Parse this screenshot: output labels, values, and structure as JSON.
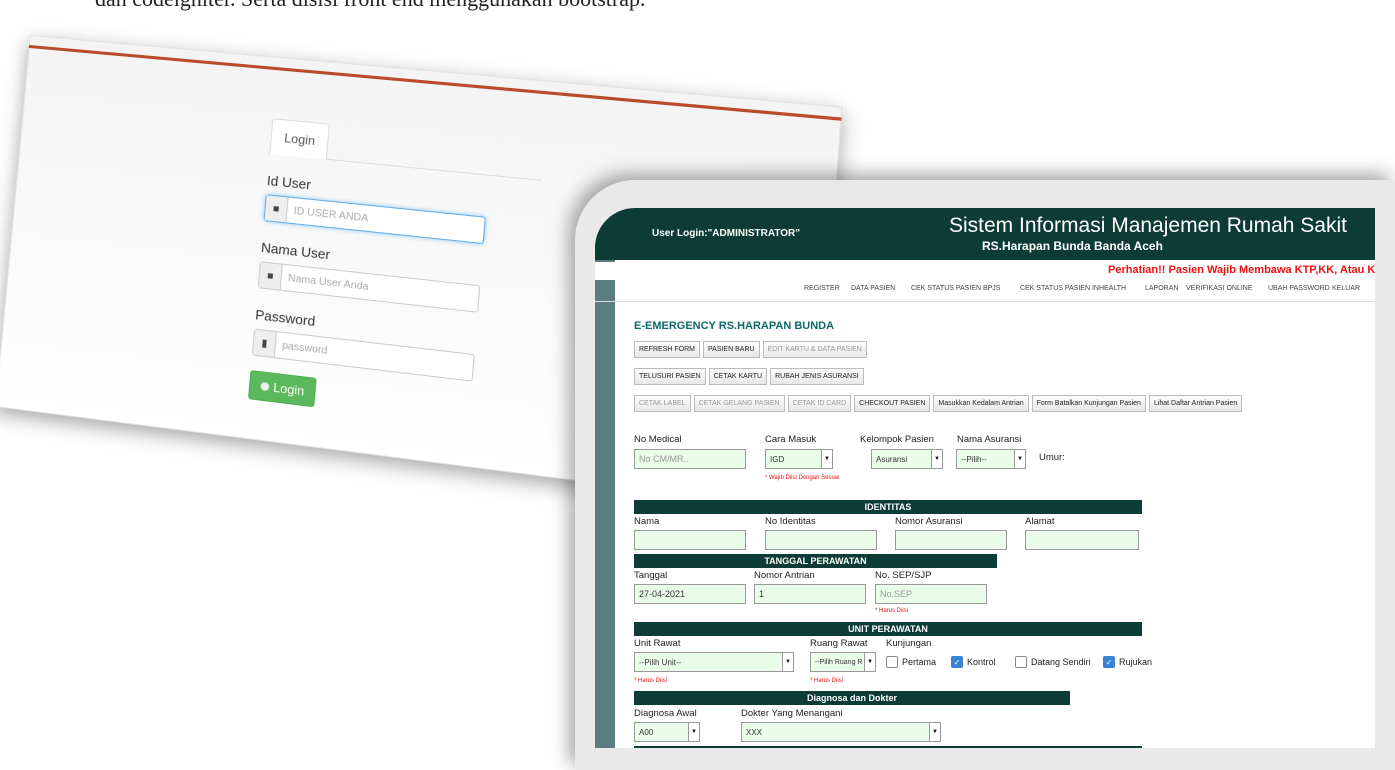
{
  "caption": "dan codeigniter. Serta disisi front end menggunakan bootstrap.",
  "login": {
    "tab": "Login",
    "id_label": "Id User",
    "id_placeholder": "ID USER ANDA",
    "name_label": "Nama User",
    "name_placeholder": "Nama User Anda",
    "pass_label": "Password",
    "pass_placeholder": "password",
    "button": "Login"
  },
  "app": {
    "user_login": "User Login:\"ADMINISTRATOR\"",
    "title": "Sistem Informasi Manajemen Rumah Sakit",
    "subtitle": "RS.Harapan Bunda Banda Aceh",
    "warning": "Perhatian!! Pasien Wajib Membawa KTP,KK, Atau Kartu",
    "nav": [
      "REGISTER",
      "DATA PASIEN",
      "CEK STATUS PASIEN BPJS",
      "CEK STATUS PASIEN INHEALTH",
      "LAPORAN",
      "VERIFIKASI ONLINE",
      "UBAH PASSWORD",
      "KELUAR"
    ],
    "page_title": "E-EMERGENCY RS.HARAPAN BUNDA",
    "buttons_row1": [
      "REFRESH FORM",
      "PASIEN BARU",
      "EDIT KARTU & DATA PASIEN"
    ],
    "buttons_row2": [
      "TELUSURI PASIEN",
      "CETAK KARTU",
      "RUBAH JENIS ASURANSI"
    ],
    "buttons_row3": [
      "CETAK LABEL",
      "CETAK GELANG PASIEN",
      "CETAK ID CARD",
      "CHECKOUT PASIEN",
      "Masukkan Kedalam Antrian",
      "Form Batalkan Kunjungan Pasien",
      "Lihat Daftar Antrian Pasien"
    ],
    "top_form": {
      "no_medical_label": "No Medical",
      "no_medical_placeholder": "No CM/MR..",
      "cara_masuk_label": "Cara Masuk",
      "cara_masuk_value": "IGD",
      "kelompok_label": "Kelompok Pasien",
      "kelompok_value": "Asuransi",
      "asuransi_label": "Nama Asuransi",
      "asuransi_value": "--Pilih--",
      "umur_label": "Umur:",
      "note": "* Wajib Diisi Dengan Sesuai"
    },
    "identitas": {
      "header": "IDENTITAS",
      "labels": [
        "Nama",
        "No Identitas",
        "Nomor Asuransi",
        "Alamat"
      ]
    },
    "perawatan": {
      "header": "TANGGAL PERAWATAN",
      "tanggal_label": "Tanggal",
      "tanggal_value": "27-04-2021",
      "antrian_label": "Nomor Antrian",
      "antrian_value": "1",
      "sep_label": "No. SEP/SJP",
      "sep_placeholder": "No.SEP",
      "note": "* Harus Diisi"
    },
    "unit": {
      "header": "UNIT PERAWATAN",
      "unit_label": "Unit Rawat",
      "unit_value": "--Pilih Unit--",
      "ruang_label": "Ruang Rawat",
      "ruang_value": "--Pilih Ruang R",
      "kunjungan_label": "Kunjungan",
      "checks": [
        {
          "label": "Pertama",
          "checked": false
        },
        {
          "label": "Kontrol",
          "checked": true
        },
        {
          "label": "Datang Sendiri",
          "checked": false
        },
        {
          "label": "Rujukan",
          "checked": true
        }
      ],
      "note1": "* Harus Diisi",
      "note2": "* Harus Diisi"
    },
    "diagnosa": {
      "header": "Diagnosa dan Dokter",
      "awal_label": "Diagnosa Awal",
      "awal_value": "A00",
      "dokter_label": "Dokter Yang Menangani",
      "dokter_value": "XXX"
    }
  }
}
